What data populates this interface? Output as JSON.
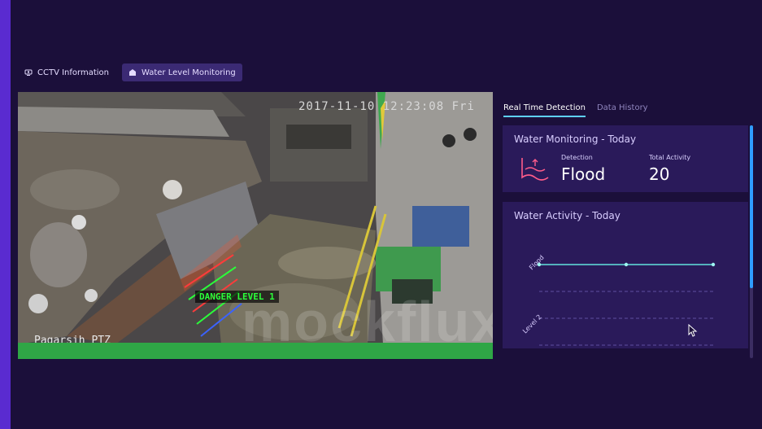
{
  "top_tabs": [
    {
      "label": "CCTV Information",
      "icon": "cctv-icon"
    },
    {
      "label": "Water Level Monitoring",
      "icon": "water-level-icon"
    }
  ],
  "camera": {
    "timestamp": "2017-11-10 12:23:08 Fri",
    "location": "Pagarsih PTZ",
    "danger_label": "DANGER LEVEL 1",
    "watermark": "mockflux"
  },
  "right_tabs": [
    {
      "label": "Real Time Detection"
    },
    {
      "label": "Data History"
    }
  ],
  "water_monitoring": {
    "title": "Water Monitoring - Today",
    "icon": "flood-wave-icon",
    "detection_label": "Detection",
    "detection_value": "Flood",
    "total_label": "Total Activity",
    "total_value": "20"
  },
  "water_activity": {
    "title": "Water Activity - Today",
    "levels": [
      "Flood",
      "Level 2"
    ]
  },
  "colors": {
    "background": "#1b0f3a",
    "panel": "#2a1a5a",
    "accent": "#5ed0ff",
    "danger_line": "#ff3b3b",
    "flood_icon": "#ff5c8a"
  }
}
